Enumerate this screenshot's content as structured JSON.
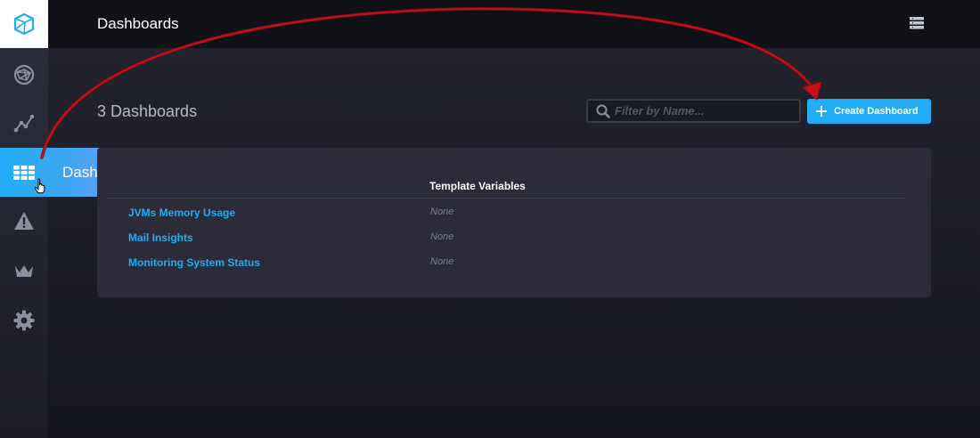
{
  "header": {
    "title": "Dashboards"
  },
  "sidebar": {
    "items": [
      {
        "icon": "data-explorer-icon"
      },
      {
        "icon": "graph-icon"
      },
      {
        "icon": "dashboards-icon",
        "active": true
      },
      {
        "icon": "alert-icon"
      },
      {
        "icon": "crown-icon"
      },
      {
        "icon": "gear-icon"
      }
    ],
    "hover_label": "Dashboards"
  },
  "main": {
    "count_label": "3 Dashboards",
    "filter_placeholder": "Filter by Name...",
    "create_label": "Create Dashboard",
    "table": {
      "columns": [
        "",
        "Template Variables"
      ],
      "rows": [
        {
          "name": "JVMs Memory Usage",
          "template_vars": "None"
        },
        {
          "name": "Mail Insights",
          "template_vars": "None"
        },
        {
          "name": "Monitoring System Status",
          "template_vars": "None"
        }
      ]
    }
  },
  "colors": {
    "accent": "#22adf6",
    "arrow": "#c8101c"
  }
}
